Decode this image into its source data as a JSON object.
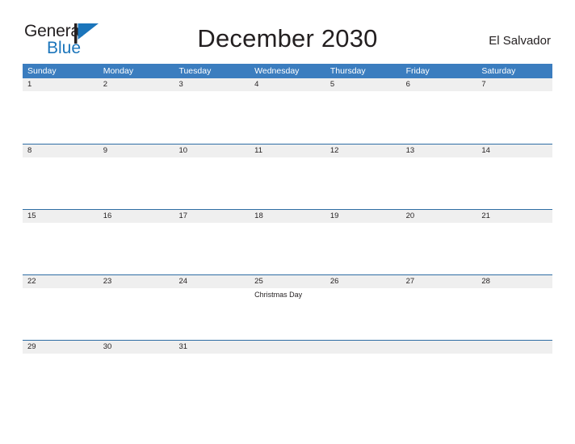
{
  "brand": {
    "line1": "General",
    "line2": "Blue",
    "flag_icon": "blue-triangle-flag-icon",
    "accent_color": "#1b75bb"
  },
  "header": {
    "title": "December 2030",
    "country": "El Salvador"
  },
  "theme": {
    "header_blue": "#3b7dbf",
    "row_divider_blue": "#2e6da4",
    "date_band_gray": "#efefef",
    "text_color": "#231f20"
  },
  "calendar": {
    "weekdays": [
      "Sunday",
      "Monday",
      "Tuesday",
      "Wednesday",
      "Thursday",
      "Friday",
      "Saturday"
    ],
    "weeks": [
      {
        "days": [
          {
            "number": "1",
            "events": []
          },
          {
            "number": "2",
            "events": []
          },
          {
            "number": "3",
            "events": []
          },
          {
            "number": "4",
            "events": []
          },
          {
            "number": "5",
            "events": []
          },
          {
            "number": "6",
            "events": []
          },
          {
            "number": "7",
            "events": []
          }
        ]
      },
      {
        "days": [
          {
            "number": "8",
            "events": []
          },
          {
            "number": "9",
            "events": []
          },
          {
            "number": "10",
            "events": []
          },
          {
            "number": "11",
            "events": []
          },
          {
            "number": "12",
            "events": []
          },
          {
            "number": "13",
            "events": []
          },
          {
            "number": "14",
            "events": []
          }
        ]
      },
      {
        "days": [
          {
            "number": "15",
            "events": []
          },
          {
            "number": "16",
            "events": []
          },
          {
            "number": "17",
            "events": []
          },
          {
            "number": "18",
            "events": []
          },
          {
            "number": "19",
            "events": []
          },
          {
            "number": "20",
            "events": []
          },
          {
            "number": "21",
            "events": []
          }
        ]
      },
      {
        "days": [
          {
            "number": "22",
            "events": []
          },
          {
            "number": "23",
            "events": []
          },
          {
            "number": "24",
            "events": []
          },
          {
            "number": "25",
            "events": [
              "Christmas Day"
            ]
          },
          {
            "number": "26",
            "events": []
          },
          {
            "number": "27",
            "events": []
          },
          {
            "number": "28",
            "events": []
          }
        ]
      },
      {
        "days": [
          {
            "number": "29",
            "events": []
          },
          {
            "number": "30",
            "events": []
          },
          {
            "number": "31",
            "events": []
          },
          {
            "number": "",
            "events": []
          },
          {
            "number": "",
            "events": []
          },
          {
            "number": "",
            "events": []
          },
          {
            "number": "",
            "events": []
          }
        ]
      }
    ]
  }
}
